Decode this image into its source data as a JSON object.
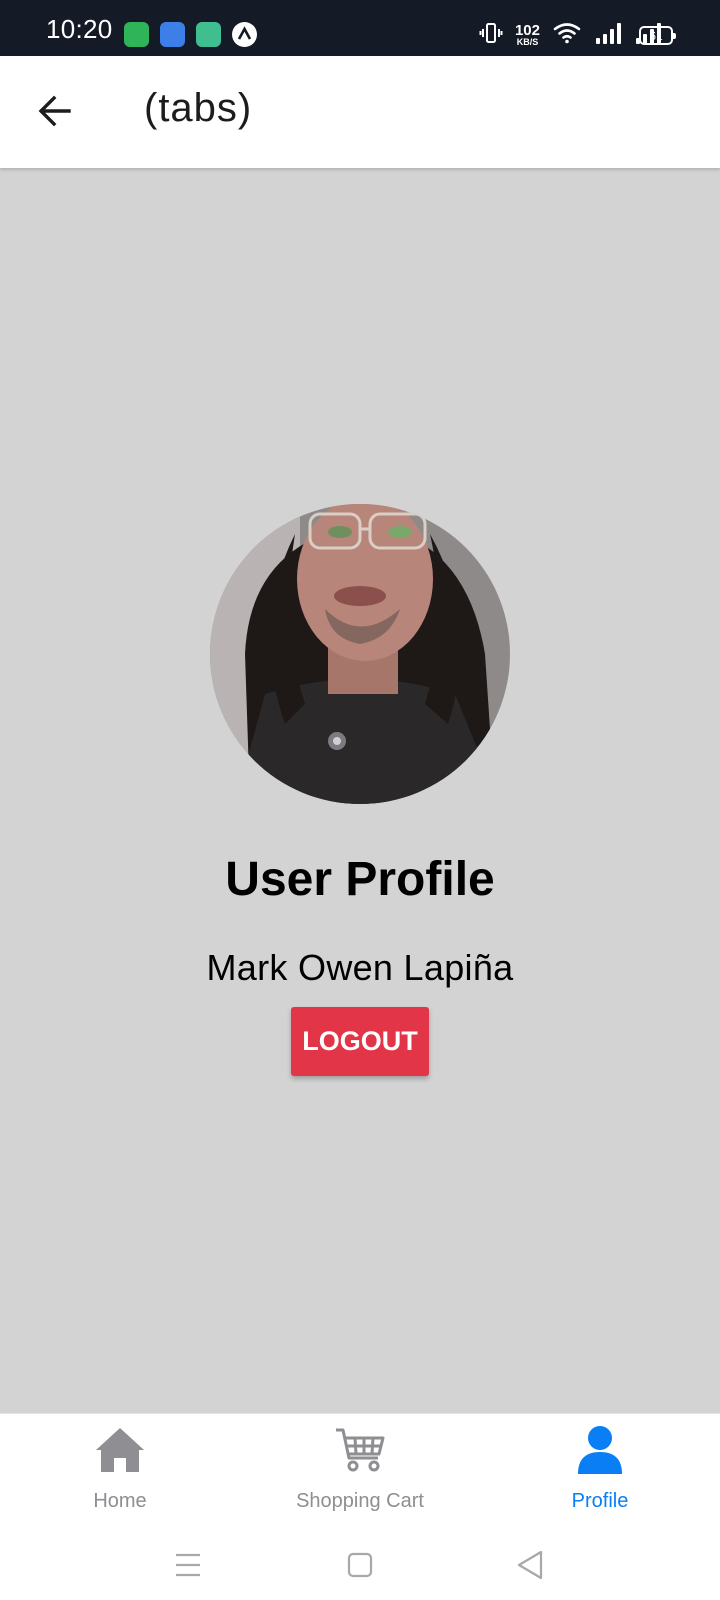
{
  "status_bar": {
    "time": "10:20",
    "net_speed_value": "102",
    "net_speed_unit": "KB/S",
    "battery_level": "61"
  },
  "header": {
    "title": "(tabs)"
  },
  "profile": {
    "title": "User Profile",
    "name": "Mark Owen Lapiña",
    "logout_label": "LOGOUT"
  },
  "tabs": [
    {
      "label": "Home",
      "icon": "home-icon",
      "active": false
    },
    {
      "label": "Shopping Cart",
      "icon": "cart-icon",
      "active": false
    },
    {
      "label": "Profile",
      "icon": "person-icon",
      "active": true
    }
  ],
  "colors": {
    "active_tab": "#0a7ff5",
    "inactive_tab": "#8e8e93",
    "logout_button": "#e33548",
    "content_background": "#d3d3d3",
    "status_bar": "#151b26"
  }
}
